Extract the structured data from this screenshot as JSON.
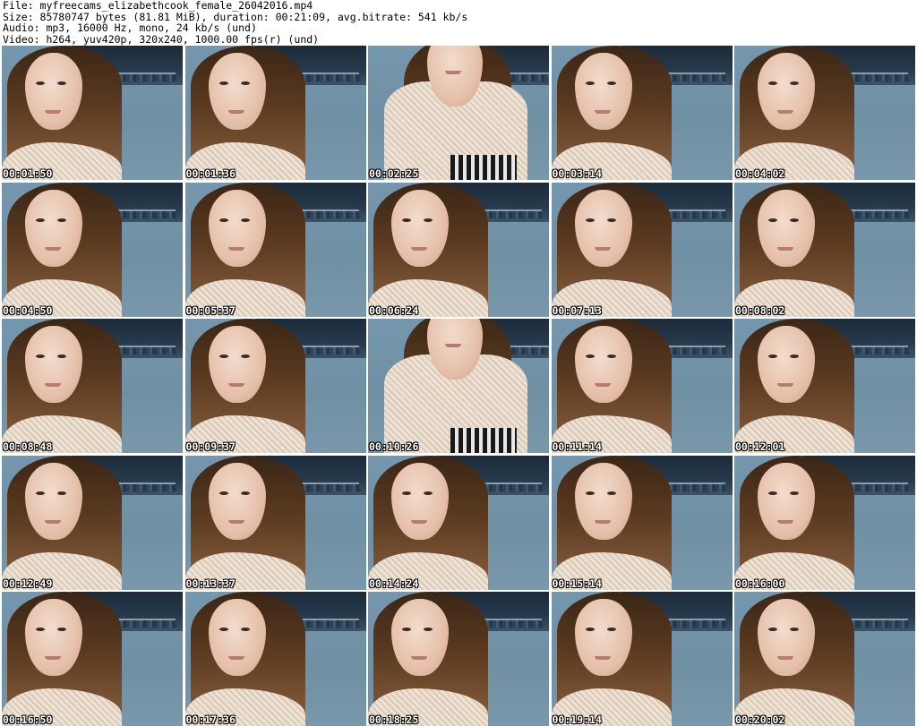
{
  "header": {
    "file_line": "File: myfreecams_elizabethcook_female_26042016.mp4",
    "size_line": "Size: 85780747 bytes (81.81 MiB), duration: 00:21:09, avg.bitrate: 541 kb/s",
    "audio_line": "Audio: mp3, 16000 Hz, mono, 24 kb/s (und)",
    "video_line": "Video: h264, yuv420p, 320x240, 1000.00 fps(r) (und)"
  },
  "thumbnails": [
    {
      "timestamp": "00:01:50",
      "variant": "normal"
    },
    {
      "timestamp": "00:01:36",
      "variant": "normal"
    },
    {
      "timestamp": "00:02:25",
      "variant": "lean"
    },
    {
      "timestamp": "00:03:14",
      "variant": "normal"
    },
    {
      "timestamp": "00:04:02",
      "variant": "normal"
    },
    {
      "timestamp": "00:04:50",
      "variant": "normal"
    },
    {
      "timestamp": "00:05:37",
      "variant": "normal"
    },
    {
      "timestamp": "00:06:24",
      "variant": "normal"
    },
    {
      "timestamp": "00:07:13",
      "variant": "normal"
    },
    {
      "timestamp": "00:08:02",
      "variant": "normal"
    },
    {
      "timestamp": "00:08:48",
      "variant": "normal"
    },
    {
      "timestamp": "00:09:37",
      "variant": "normal"
    },
    {
      "timestamp": "00:10:26",
      "variant": "lean"
    },
    {
      "timestamp": "00:11:14",
      "variant": "normal"
    },
    {
      "timestamp": "00:12:01",
      "variant": "normal"
    },
    {
      "timestamp": "00:12:49",
      "variant": "normal"
    },
    {
      "timestamp": "00:13:37",
      "variant": "normal"
    },
    {
      "timestamp": "00:14:24",
      "variant": "normal"
    },
    {
      "timestamp": "00:15:14",
      "variant": "normal"
    },
    {
      "timestamp": "00:16:00",
      "variant": "normal"
    },
    {
      "timestamp": "00:16:50",
      "variant": "normal"
    },
    {
      "timestamp": "00:17:36",
      "variant": "normal"
    },
    {
      "timestamp": "00:18:25",
      "variant": "normal"
    },
    {
      "timestamp": "00:19:14",
      "variant": "normal"
    },
    {
      "timestamp": "00:20:02",
      "variant": "normal"
    }
  ],
  "colors": {
    "background": "#ffffff",
    "header_text": "#000000",
    "timestamp_text": "#ffffff",
    "timestamp_outline": "#000000"
  }
}
